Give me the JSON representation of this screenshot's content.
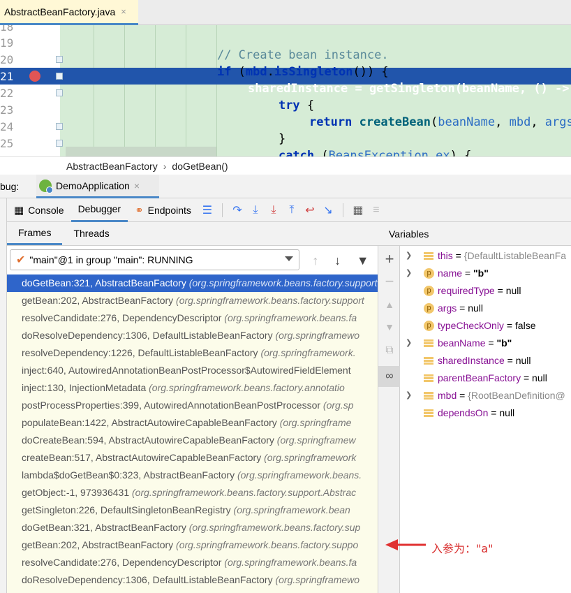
{
  "editor_tab": {
    "file": "AbstractBeanFactory.java",
    "close": "×"
  },
  "editor": {
    "line_numbers": [
      "18",
      "19",
      "20",
      "21",
      "22",
      "23",
      "24",
      "25"
    ],
    "lines": [
      {
        "plain": "// Create bean instance."
      },
      {
        "kw": "if",
        "rest1": " (",
        "id": "mbd",
        "rest2": ".",
        "fn": "isSingleton",
        "rest3": "()) {"
      },
      {
        "text": "sharedInstance = getSingleton(beanName, () ->"
      },
      {
        "kw": "try",
        "rest": " {"
      },
      {
        "kw": "return",
        "fn": " createBean",
        "rest1": "(",
        "p1": "beanName",
        "rest2": ", ",
        "p2": "mbd",
        "rest3": ", ",
        "p3": "args",
        "rest4": ")"
      },
      {
        "rest": "}"
      },
      {
        "kw": "catch",
        "rest1": " (",
        "ty": "BeansException",
        "rest2": " ",
        "p1": "ex",
        "rest3": ") {"
      }
    ]
  },
  "breadcrumb": {
    "class": "AbstractBeanFactory",
    "separator": "›",
    "method": "doGetBean()"
  },
  "debug_window": {
    "label": "bug:",
    "run_config": "DemoApplication",
    "close": "×"
  },
  "toolbar": {
    "console": "Console",
    "debugger": "Debugger",
    "endpoints": "Endpoints"
  },
  "frames_panel": {
    "tab_frames": "Frames",
    "tab_threads": "Threads",
    "thread": "\"main\"@1 in group \"main\": RUNNING",
    "frames": [
      {
        "method": "doGetBean:321, AbstractBeanFactory ",
        "pkg": "(org.springframework.beans.factory.support",
        "selected": true
      },
      {
        "method": "getBean:202, AbstractBeanFactory ",
        "pkg": "(org.springframework.beans.factory.support"
      },
      {
        "method": "resolveCandidate:276, DependencyDescriptor ",
        "pkg": "(org.springframework.beans.fa"
      },
      {
        "method": "doResolveDependency:1306, DefaultListableBeanFactory ",
        "pkg": "(org.springframewo"
      },
      {
        "method": "resolveDependency:1226, DefaultListableBeanFactory ",
        "pkg": "(org.springframework."
      },
      {
        "method": "inject:640, AutowiredAnnotationBeanPostProcessor$AutowiredFieldElement",
        "pkg": ""
      },
      {
        "method": "inject:130, InjectionMetadata ",
        "pkg": "(org.springframework.beans.factory.annotatio"
      },
      {
        "method": "postProcessProperties:399, AutowiredAnnotationBeanPostProcessor ",
        "pkg": "(org.sp"
      },
      {
        "method": "populateBean:1422, AbstractAutowireCapableBeanFactory ",
        "pkg": "(org.springframe"
      },
      {
        "method": "doCreateBean:594, AbstractAutowireCapableBeanFactory ",
        "pkg": "(org.springframew"
      },
      {
        "method": "createBean:517, AbstractAutowireCapableBeanFactory ",
        "pkg": "(org.springframework"
      },
      {
        "method": "lambda$doGetBean$0:323, AbstractBeanFactory ",
        "pkg": "(org.springframework.beans."
      },
      {
        "method": "getObject:-1, 973936431 ",
        "pkg": "(org.springframework.beans.factory.support.Abstrac"
      },
      {
        "method": "getSingleton:226, DefaultSingletonBeanRegistry ",
        "pkg": "(org.springframework.bean"
      },
      {
        "method": "doGetBean:321, AbstractBeanFactory ",
        "pkg": "(org.springframework.beans.factory.sup"
      },
      {
        "method": "getBean:202, AbstractBeanFactory ",
        "pkg": "(org.springframework.beans.factory.suppo"
      },
      {
        "method": "resolveCandidate:276, DependencyDescriptor ",
        "pkg": "(org.springframework.beans.fa"
      },
      {
        "method": "doResolveDependency:1306, DefaultListableBeanFactory ",
        "pkg": "(org.springframewo"
      }
    ]
  },
  "variables_panel": {
    "title": "Variables",
    "vars": [
      {
        "expand": true,
        "icon": "field",
        "name": "this",
        "eq": " = ",
        "value": "{DefaultListableBeanFa",
        "kind": "obj"
      },
      {
        "expand": true,
        "icon": "param",
        "name": "name",
        "eq": " = ",
        "value": "\"b\"",
        "kind": "str"
      },
      {
        "expand": false,
        "icon": "param",
        "name": "requiredType",
        "eq": " = ",
        "value": "null",
        "kind": "plain"
      },
      {
        "expand": false,
        "icon": "param",
        "name": "args",
        "eq": " = ",
        "value": "null",
        "kind": "plain"
      },
      {
        "expand": false,
        "icon": "param",
        "name": "typeCheckOnly",
        "eq": " = ",
        "value": "false",
        "kind": "plain"
      },
      {
        "expand": true,
        "icon": "field",
        "name": "beanName",
        "eq": " = ",
        "value": "\"b\"",
        "kind": "str"
      },
      {
        "expand": false,
        "icon": "field",
        "name": "sharedInstance",
        "eq": " = ",
        "value": "null",
        "kind": "plain"
      },
      {
        "expand": false,
        "icon": "field",
        "name": "parentBeanFactory",
        "eq": " = ",
        "value": "null",
        "kind": "plain"
      },
      {
        "expand": true,
        "icon": "field",
        "name": "mbd",
        "eq": " = ",
        "value": "{RootBeanDefinition@",
        "kind": "obj"
      },
      {
        "expand": false,
        "icon": "field",
        "name": "dependsOn",
        "eq": " = ",
        "value": "null",
        "kind": "plain"
      }
    ],
    "param_badge": "p"
  },
  "annotation": {
    "text": "入参为：\"a\"",
    "color": "#d93030"
  },
  "colors": {
    "selection": "#2f65ca",
    "exec_line": "#2155ab",
    "code_bg": "#d6ecd6",
    "frames_bg": "#fcfcea",
    "accent": "#4a88c7"
  }
}
